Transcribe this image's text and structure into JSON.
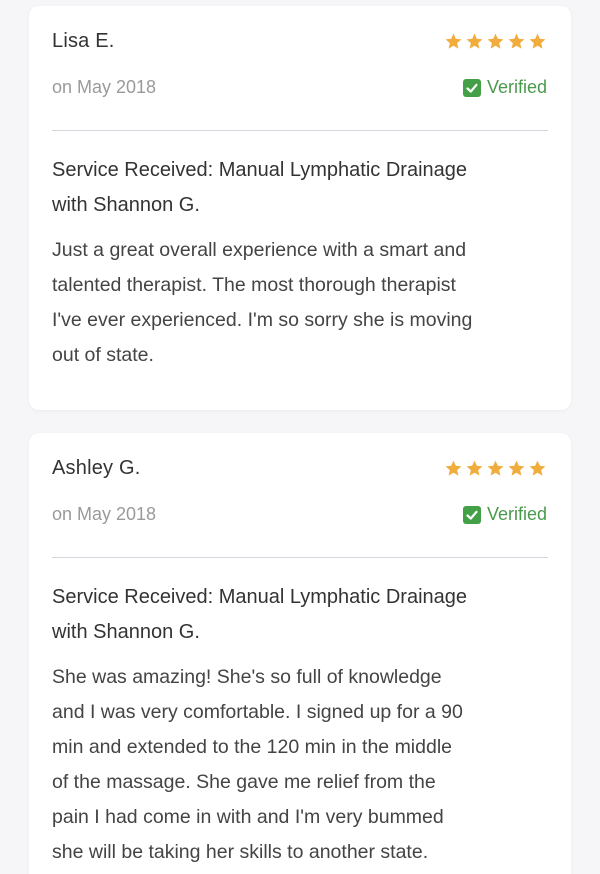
{
  "colors": {
    "star": "#f0ad3e",
    "verified": "#43a047",
    "background": "#f6f6f8",
    "card": "#ffffff"
  },
  "reviews": [
    {
      "name": "Lisa E.",
      "rating": 5,
      "date": "on May 2018",
      "verified_label": "Verified",
      "service_line1": "Service Received: Manual Lymphatic Drainage",
      "service_line2": "with Shannon G.",
      "body_lines": [
        "Just a great overall experience with a smart and",
        "talented therapist. The most thorough therapist",
        "I've ever experienced. I'm so sorry she is moving",
        "out of state."
      ]
    },
    {
      "name": "Ashley G.",
      "rating": 5,
      "date": "on May 2018",
      "verified_label": "Verified",
      "service_line1": "Service Received: Manual Lymphatic Drainage",
      "service_line2": "with Shannon G.",
      "body_lines": [
        "She was amazing! She's so full of knowledge",
        "and I was very comfortable. I signed up for a 90",
        "min and extended to the 120 min in the middle",
        "of the massage. She gave me relief from the",
        "pain I had come in with and I'm very bummed",
        "she will be taking her skills to another state."
      ]
    }
  ]
}
